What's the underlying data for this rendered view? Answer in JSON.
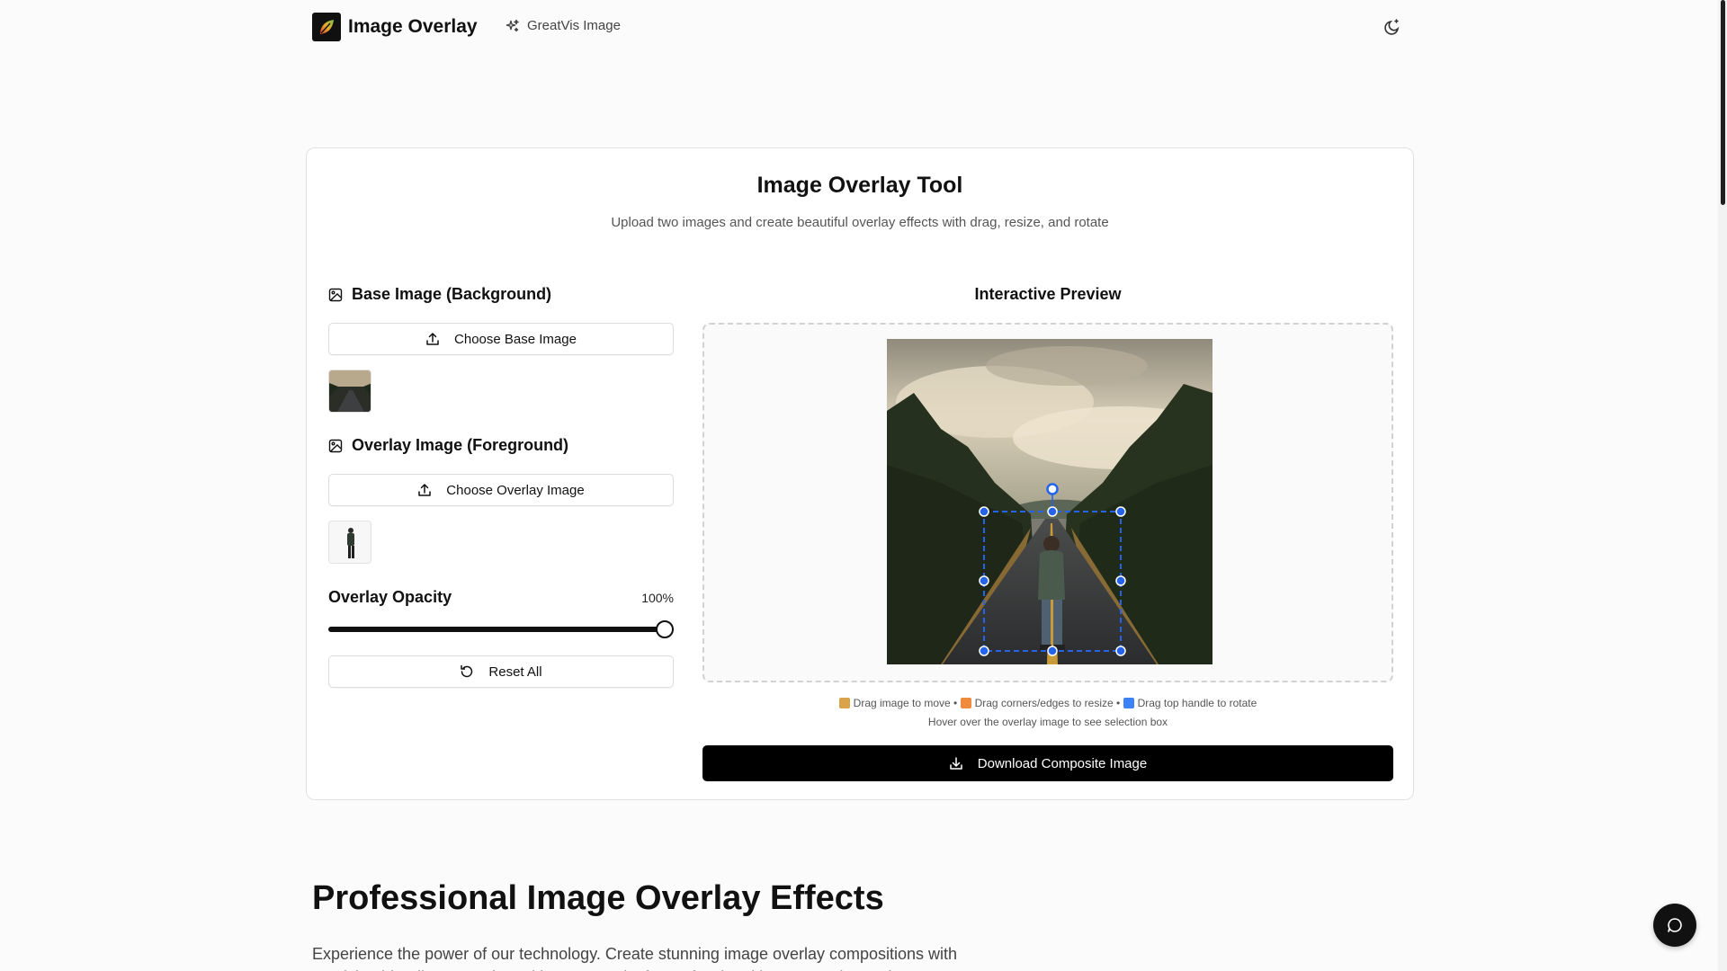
{
  "header": {
    "brand_title": "Image Overlay",
    "nav_link": "GreatVis Image",
    "logo_icon": "leaf-logo-icon",
    "theme_icon": "moon-icon"
  },
  "card": {
    "title": "Image Overlay Tool",
    "subtitle": "Upload two images and create beautiful overlay effects with drag, resize, and rotate"
  },
  "base_image": {
    "heading": "Base Image (Background)",
    "button_label": "Choose Base Image"
  },
  "overlay_image": {
    "heading": "Overlay Image (Foreground)",
    "button_label": "Choose Overlay Image"
  },
  "opacity": {
    "label": "Overlay Opacity",
    "value_text": "100%",
    "value": 1.0
  },
  "reset_label": "Reset All",
  "preview": {
    "title": "Interactive Preview",
    "hint_move": "Drag image to move",
    "hint_resize": "Drag corners/edges to resize",
    "hint_rotate": "Drag top handle to rotate",
    "separator": "•",
    "hint_hover": "Hover over the overlay image to see selection box"
  },
  "download_label": "Download Composite Image",
  "promo": {
    "title": "Professional Image Overlay Effects",
    "text": "Experience the power of our technology. Create stunning image overlay compositions with precision blending controls and instant results for professional image overlay projects."
  },
  "colors": {
    "accent": "#2563eb",
    "primary": "#000000",
    "border": "#e2e2e2"
  }
}
